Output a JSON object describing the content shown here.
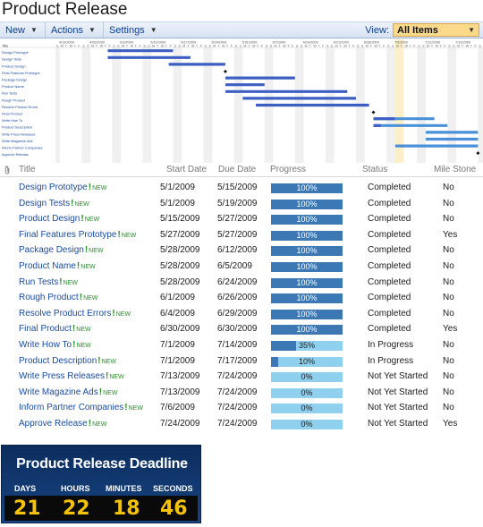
{
  "page": {
    "title": "Product Release"
  },
  "toolbar": {
    "new_label": "New",
    "actions_label": "Actions",
    "settings_label": "Settings",
    "view_label": "View:",
    "view_value": "All Items"
  },
  "gantt": {
    "week_labels": [
      "4/19/2009",
      "4/26/2009",
      "5/3/2009",
      "5/10/2009",
      "5/17/2009",
      "5/24/2009",
      "5/31/2009",
      "6/7/2009",
      "6/14/2009",
      "6/21/2009",
      "6/28/2009",
      "7/5/2009",
      "7/12/2009",
      "7/19/2009"
    ],
    "day_letters": "SMTWTFS",
    "task_labels": [
      "Title",
      "Design Prototype",
      "Design Tests",
      "Product Design",
      "Final Features Prototype",
      "Package Design",
      "Product Name",
      "Run Tests",
      "Rough Product",
      "Resolve Product Errors",
      "Final Product",
      "Write How To",
      "Product Description",
      "Write Press Releases",
      "Write Magazine Ads",
      "Inform Partner Companies",
      "Approve Release"
    ]
  },
  "grid": {
    "columns": {
      "title": "Title",
      "start": "Start Date",
      "due": "Due Date",
      "progress": "Progress",
      "status": "Status",
      "milestone": "Mile Stone"
    },
    "new_tag": "NEW",
    "new_mark": "!",
    "rows": [
      {
        "title": "Design Prototype",
        "start": "5/1/2009",
        "due": "5/15/2009",
        "progress": 1.0,
        "progress_label": "100%",
        "status": "Completed",
        "milestone": "No"
      },
      {
        "title": "Design Tests",
        "start": "5/1/2009",
        "due": "5/19/2009",
        "progress": 1.0,
        "progress_label": "100%",
        "status": "Completed",
        "milestone": "No"
      },
      {
        "title": "Product Design",
        "start": "5/15/2009",
        "due": "5/27/2009",
        "progress": 1.0,
        "progress_label": "100%",
        "status": "Completed",
        "milestone": "No"
      },
      {
        "title": "Final Features Prototype",
        "start": "5/27/2009",
        "due": "5/27/2009",
        "progress": 1.0,
        "progress_label": "100%",
        "status": "Completed",
        "milestone": "Yes"
      },
      {
        "title": "Package Design",
        "start": "5/28/2009",
        "due": "6/12/2009",
        "progress": 1.0,
        "progress_label": "100%",
        "status": "Completed",
        "milestone": "No"
      },
      {
        "title": "Product Name",
        "start": "5/28/2009",
        "due": "6/5/2009",
        "progress": 1.0,
        "progress_label": "100%",
        "status": "Completed",
        "milestone": "No"
      },
      {
        "title": "Run Tests",
        "start": "5/28/2009",
        "due": "6/24/2009",
        "progress": 1.0,
        "progress_label": "100%",
        "status": "Completed",
        "milestone": "No"
      },
      {
        "title": "Rough Product",
        "start": "6/1/2009",
        "due": "6/26/2009",
        "progress": 1.0,
        "progress_label": "100%",
        "status": "Completed",
        "milestone": "No"
      },
      {
        "title": "Resolve Product Errors",
        "start": "6/4/2009",
        "due": "6/29/2009",
        "progress": 1.0,
        "progress_label": "100%",
        "status": "Completed",
        "milestone": "No"
      },
      {
        "title": "Final Product",
        "start": "6/30/2009",
        "due": "6/30/2009",
        "progress": 1.0,
        "progress_label": "100%",
        "status": "Completed",
        "milestone": "Yes"
      },
      {
        "title": "Write How To",
        "start": "7/1/2009",
        "due": "7/14/2009",
        "progress": 0.35,
        "progress_label": "35%",
        "status": "In Progress",
        "milestone": "No"
      },
      {
        "title": "Product Description",
        "start": "7/1/2009",
        "due": "7/17/2009",
        "progress": 0.1,
        "progress_label": "10%",
        "status": "In Progress",
        "milestone": "No"
      },
      {
        "title": "Write Press Releases",
        "start": "7/13/2009",
        "due": "7/24/2009",
        "progress": 0.0,
        "progress_label": "0%",
        "status": "Not Yet Started",
        "milestone": "No"
      },
      {
        "title": "Write Magazine Ads",
        "start": "7/13/2009",
        "due": "7/24/2009",
        "progress": 0.0,
        "progress_label": "0%",
        "status": "Not Yet Started",
        "milestone": "No"
      },
      {
        "title": "Inform Partner Companies",
        "start": "7/6/2009",
        "due": "7/24/2009",
        "progress": 0.0,
        "progress_label": "0%",
        "status": "Not Yet Started",
        "milestone": "No"
      },
      {
        "title": "Approve Release",
        "start": "7/24/2009",
        "due": "7/24/2009",
        "progress": 0.0,
        "progress_label": "0%",
        "status": "Not Yet Started",
        "milestone": "Yes"
      }
    ]
  },
  "countdown": {
    "title": "Product Release Deadline",
    "labels": [
      "DAYS",
      "HOURS",
      "MINUTES",
      "SECONDS"
    ],
    "values": [
      "21",
      "22",
      "18",
      "46"
    ]
  },
  "colors": {
    "progress_fill": "#3b78b4",
    "progress_track": "#8fd0ee",
    "gantt_done": "#3d5fc4",
    "gantt_todo": "#4a90d9",
    "today_highlight": "#fdf0c8",
    "new_tag": "#2b8a2b"
  },
  "icons": {
    "attachment": "paperclip-icon",
    "new_flag": "new-flag-icon",
    "dropdown": "chevron-down-icon"
  }
}
